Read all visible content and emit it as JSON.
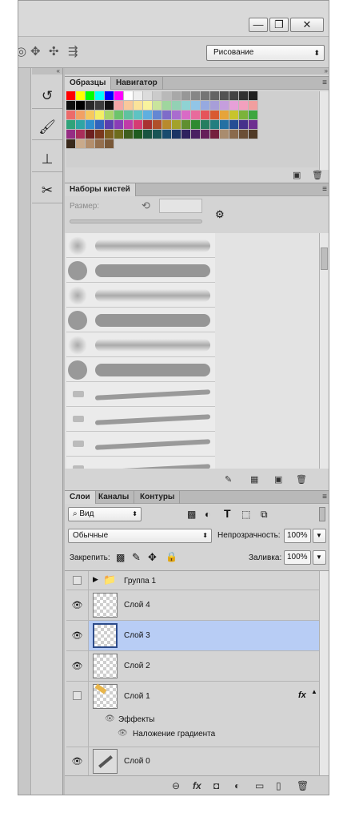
{
  "window": {
    "minimize_icon": "minimize-icon",
    "restore_icon": "restore-icon",
    "close_icon": "close-icon",
    "minimize_glyph": "—",
    "restore_glyph": "❐",
    "close_glyph": "✕"
  },
  "options": {
    "workspace": "Рисование",
    "icons": [
      "3d-rotate-icon",
      "3d-roll-icon",
      "3d-pan-icon",
      "3d-video-icon"
    ]
  },
  "swatches_panel": {
    "tabs": [
      "Образцы",
      "Навигатор"
    ],
    "colors": [
      [
        "#ff0000",
        "#ffff00",
        "#00ff00",
        "#00ffff",
        "#0000ff",
        "#ff00ff",
        "#ffffff",
        "#eeeeee",
        "#dcdcdc",
        "#cbcbcb",
        "#b9b9b9",
        "#a8a8a8",
        "#979797",
        "#868686",
        "#757575",
        "#646464",
        "#535353",
        "#424242",
        "#313131",
        "#1f1f1f"
      ],
      [
        "#0f0f0f",
        "#000000",
        "#2a2a2a",
        "#3c3c3c",
        "#111111",
        "#f4a6a6",
        "#f9c89b",
        "#fbe39a",
        "#f9f39d",
        "#c9e59c",
        "#9fd69e",
        "#93d1b4",
        "#8fd3d3",
        "#91c5e7",
        "#96a9e0",
        "#a79ed8",
        "#c59edd",
        "#e7a0d8",
        "#f2a0be",
        "#f19f9f"
      ],
      [
        "#ec6a6a",
        "#f2a064",
        "#f6c85e",
        "#f4ee66",
        "#a8d56a",
        "#6cc46b",
        "#5fc2a0",
        "#5ec3c3",
        "#5fafe0",
        "#6487d3",
        "#7e6cc9",
        "#a96ccf",
        "#d96ac6",
        "#e86b9c",
        "#e5545a",
        "#d85a31",
        "#e6a43a",
        "#c7c42c",
        "#7bb33b",
        "#3da63f"
      ],
      [
        "#2fa37a",
        "#2ea5a5",
        "#2f8fcd",
        "#3064be",
        "#5a3fb0",
        "#8a3cb7",
        "#c03ba8",
        "#d63b73",
        "#a93232",
        "#b0502a",
        "#b88a2d",
        "#a3a22a",
        "#5f8f2f",
        "#2f8a30",
        "#257e60",
        "#247e7f",
        "#2470a3",
        "#254d94",
        "#46318b",
        "#6d2f90"
      ],
      [
        "#962d84",
        "#a92e5a",
        "#6d2020",
        "#7a381d",
        "#7d5e1e",
        "#6d6c1c",
        "#3f5f1f",
        "#1f5c20",
        "#195441",
        "#185455",
        "#194b6e",
        "#1a3464",
        "#2f215e",
        "#4a2062",
        "#651e59",
        "#741f3d",
        "#a98c6e",
        "#8a6a4c",
        "#6b4f36",
        "#503a26"
      ],
      [
        "#3a2a1c",
        "#c9aa8b",
        "#b38e6c",
        "#946f4e",
        "#795838"
      ]
    ]
  },
  "brushes_panel": {
    "tab": "Наборы кистей",
    "size_label": "Размер:",
    "reset_icon": "reset-icon",
    "toggle_icon": "brush-panel-icon"
  },
  "layers_panel": {
    "tabs": [
      "Слои",
      "Каналы",
      "Контуры"
    ],
    "filter_value": "Вид",
    "blend_mode": "Обычные",
    "opacity_label": "Непрозрачность:",
    "opacity_value": "100%",
    "lock_label": "Закрепить:",
    "fill_label": "Заливка:",
    "fill_value": "100%",
    "layers": [
      {
        "name": "Группа 1",
        "kind": "group",
        "visible": false
      },
      {
        "name": "Слой 4",
        "kind": "layer",
        "visible": true
      },
      {
        "name": "Слой 3",
        "kind": "layer",
        "visible": true,
        "selected": true
      },
      {
        "name": "Слой 2",
        "kind": "layer",
        "visible": true
      },
      {
        "name": "Слой 1",
        "kind": "layer",
        "visible": false,
        "fx": "fx"
      },
      {
        "name": "Слой 0",
        "kind": "layer",
        "visible": true
      }
    ],
    "effects_label": "Эффекты",
    "effect_item": "Наложение градиента",
    "fx_button": "fx",
    "eye_glyph": "👁",
    "fx_badge": "fx",
    "link_glyph": "⊖",
    "adjust_glyph": "◐",
    "mask_glyph": "◘",
    "folder_glyph": "▭",
    "new_glyph": "▯",
    "trash_glyph": "🗑"
  },
  "dock": {
    "items": [
      "history-icon",
      "brush-presets-icon",
      "clone-source-icon",
      "tool-presets-icon"
    ],
    "glyphs": [
      "↺",
      "🖌",
      "⊥",
      "✂"
    ]
  }
}
